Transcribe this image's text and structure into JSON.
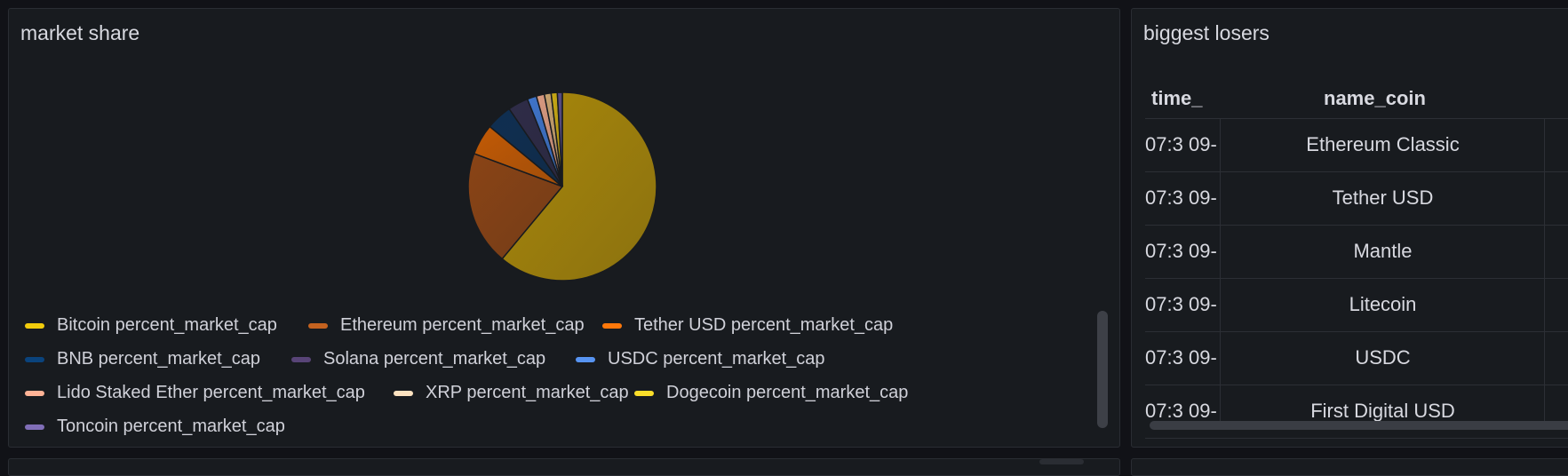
{
  "market_share": {
    "title": "market share",
    "legend": [
      {
        "label": "Bitcoin percent_market_cap",
        "color": "#f2cc0c"
      },
      {
        "label": "Ethereum percent_market_cap",
        "color": "#c4621f"
      },
      {
        "label": "Tether USD percent_market_cap",
        "color": "#ff780a"
      },
      {
        "label": "BNB percent_market_cap",
        "color": "#0a437c"
      },
      {
        "label": "Solana percent_market_cap",
        "color": "#584477"
      },
      {
        "label": "USDC percent_market_cap",
        "color": "#5794f2"
      },
      {
        "label": "Lido Staked Ether percent_market_cap",
        "color": "#ffb396"
      },
      {
        "label": "XRP percent_market_cap",
        "color": "#fce2c0"
      },
      {
        "label": "Dogecoin percent_market_cap",
        "color": "#fade2a"
      },
      {
        "label": "Toncoin percent_market_cap",
        "color": "#806eb7"
      }
    ]
  },
  "chart_data": {
    "type": "pie",
    "categories": [
      "Bitcoin percent_market_cap",
      "Ethereum percent_market_cap",
      "Tether USD percent_market_cap",
      "BNB percent_market_cap",
      "Solana percent_market_cap",
      "USDC percent_market_cap",
      "Lido Staked Ether percent_market_cap",
      "XRP percent_market_cap",
      "Dogecoin percent_market_cap",
      "Toncoin percent_market_cap"
    ],
    "values": [
      57.5,
      18.5,
      5.0,
      4.2,
      3.3,
      1.5,
      1.3,
      1.1,
      1.0,
      0.8
    ],
    "slice_colors": [
      "#a8870b",
      "#8a4416",
      "#c25a05",
      "#0f2f52",
      "#2f2c48",
      "#3f74c9",
      "#d99a80",
      "#c8a26e",
      "#c9a914",
      "#5a4d86"
    ],
    "legend_placement": "bottom-left"
  },
  "biggest_losers": {
    "title": "biggest losers",
    "columns": [
      "time_",
      "name_coin"
    ],
    "rows": [
      {
        "time": "-09 07:3",
        "name": "Ethereum Classic"
      },
      {
        "time": "-09 07:3",
        "name": "Tether USD"
      },
      {
        "time": "-09 07:3",
        "name": "Mantle"
      },
      {
        "time": "-09 07:3",
        "name": "Litecoin"
      },
      {
        "time": "-09 07:3",
        "name": "USDC"
      },
      {
        "time": "-09 07:3",
        "name": "First Digital USD"
      }
    ]
  }
}
